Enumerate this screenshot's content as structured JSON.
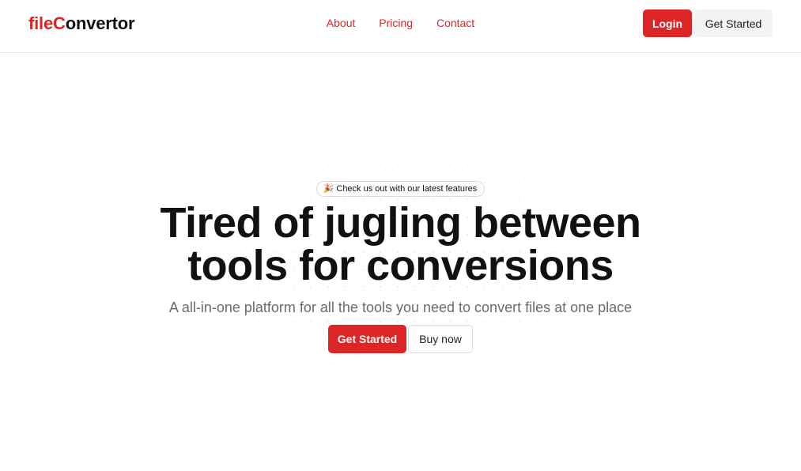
{
  "navbar": {
    "logo": {
      "part1": "file",
      "part2": "C",
      "part3": "onvertor"
    },
    "links": [
      "About",
      "Pricing",
      "Contact"
    ],
    "login_label": "Login",
    "get_started_label": "Get Started"
  },
  "hero": {
    "badge_icon": "🎉",
    "badge_text": "Check us out with our latest features",
    "headline_line1": "Tired of jugling between",
    "headline_line2": "tools for conversions",
    "subtitle": "A all-in-one platform for all the tools you need to convert files at one place",
    "primary_cta": "Get Started",
    "secondary_cta": "Buy now"
  },
  "colors": {
    "accent": "#dc2626",
    "text": "#111111",
    "muted": "#6b6b6b"
  }
}
